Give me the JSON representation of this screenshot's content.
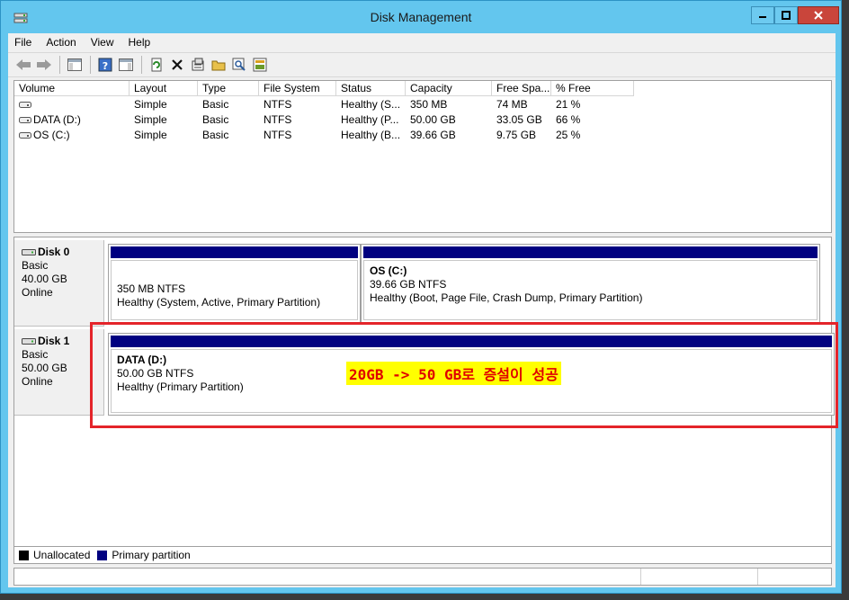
{
  "window": {
    "title": "Disk Management"
  },
  "menu": [
    "File",
    "Action",
    "View",
    "Help"
  ],
  "toolbar": [
    "back-icon",
    "forward-icon",
    "show-hide-console-tree-icon",
    "help-icon",
    "show-hide-action-pane-icon",
    "refresh-icon",
    "delete-icon",
    "properties-icon",
    "open-icon",
    "explore-icon",
    "help-topics-icon"
  ],
  "volume_list": {
    "columns": [
      "Volume",
      "Layout",
      "Type",
      "File System",
      "Status",
      "Capacity",
      "Free Spa...",
      "% Free"
    ],
    "rows": [
      [
        "",
        "Simple",
        "Basic",
        "NTFS",
        "Healthy (S...",
        "350 MB",
        "74 MB",
        "21 %"
      ],
      [
        "DATA (D:)",
        "Simple",
        "Basic",
        "NTFS",
        "Healthy (P...",
        "50.00 GB",
        "33.05 GB",
        "66 %"
      ],
      [
        "OS (C:)",
        "Simple",
        "Basic",
        "NTFS",
        "Healthy (B...",
        "39.66 GB",
        "9.75 GB",
        "25 %"
      ]
    ]
  },
  "disks": [
    {
      "name": "Disk 0",
      "type": "Basic",
      "size": "40.00 GB",
      "state": "Online",
      "partitions": [
        {
          "title": "",
          "size": "350 MB NTFS",
          "status": "Healthy (System, Active, Primary Partition)"
        },
        {
          "title": "OS  (C:)",
          "size": "39.66 GB NTFS",
          "status": "Healthy (Boot, Page File, Crash Dump, Primary Partition)"
        }
      ]
    },
    {
      "name": "Disk 1",
      "type": "Basic",
      "size": "50.00 GB",
      "state": "Online",
      "partitions": [
        {
          "title": "DATA  (D:)",
          "size": "50.00 GB NTFS",
          "status": "Healthy (Primary Partition)"
        }
      ]
    }
  ],
  "annotation": "20GB -> 50 GB로 증설이 성공",
  "legend": [
    {
      "label": "Unallocated",
      "color": "#000000"
    },
    {
      "label": "Primary partition",
      "color": "#000080"
    }
  ],
  "colors": {
    "titlebar": "#63c6ee",
    "partition_bar": "#000080",
    "highlight": "#e4242a",
    "annotation_bg": "#ffff00",
    "annotation_text": "#e00000"
  }
}
